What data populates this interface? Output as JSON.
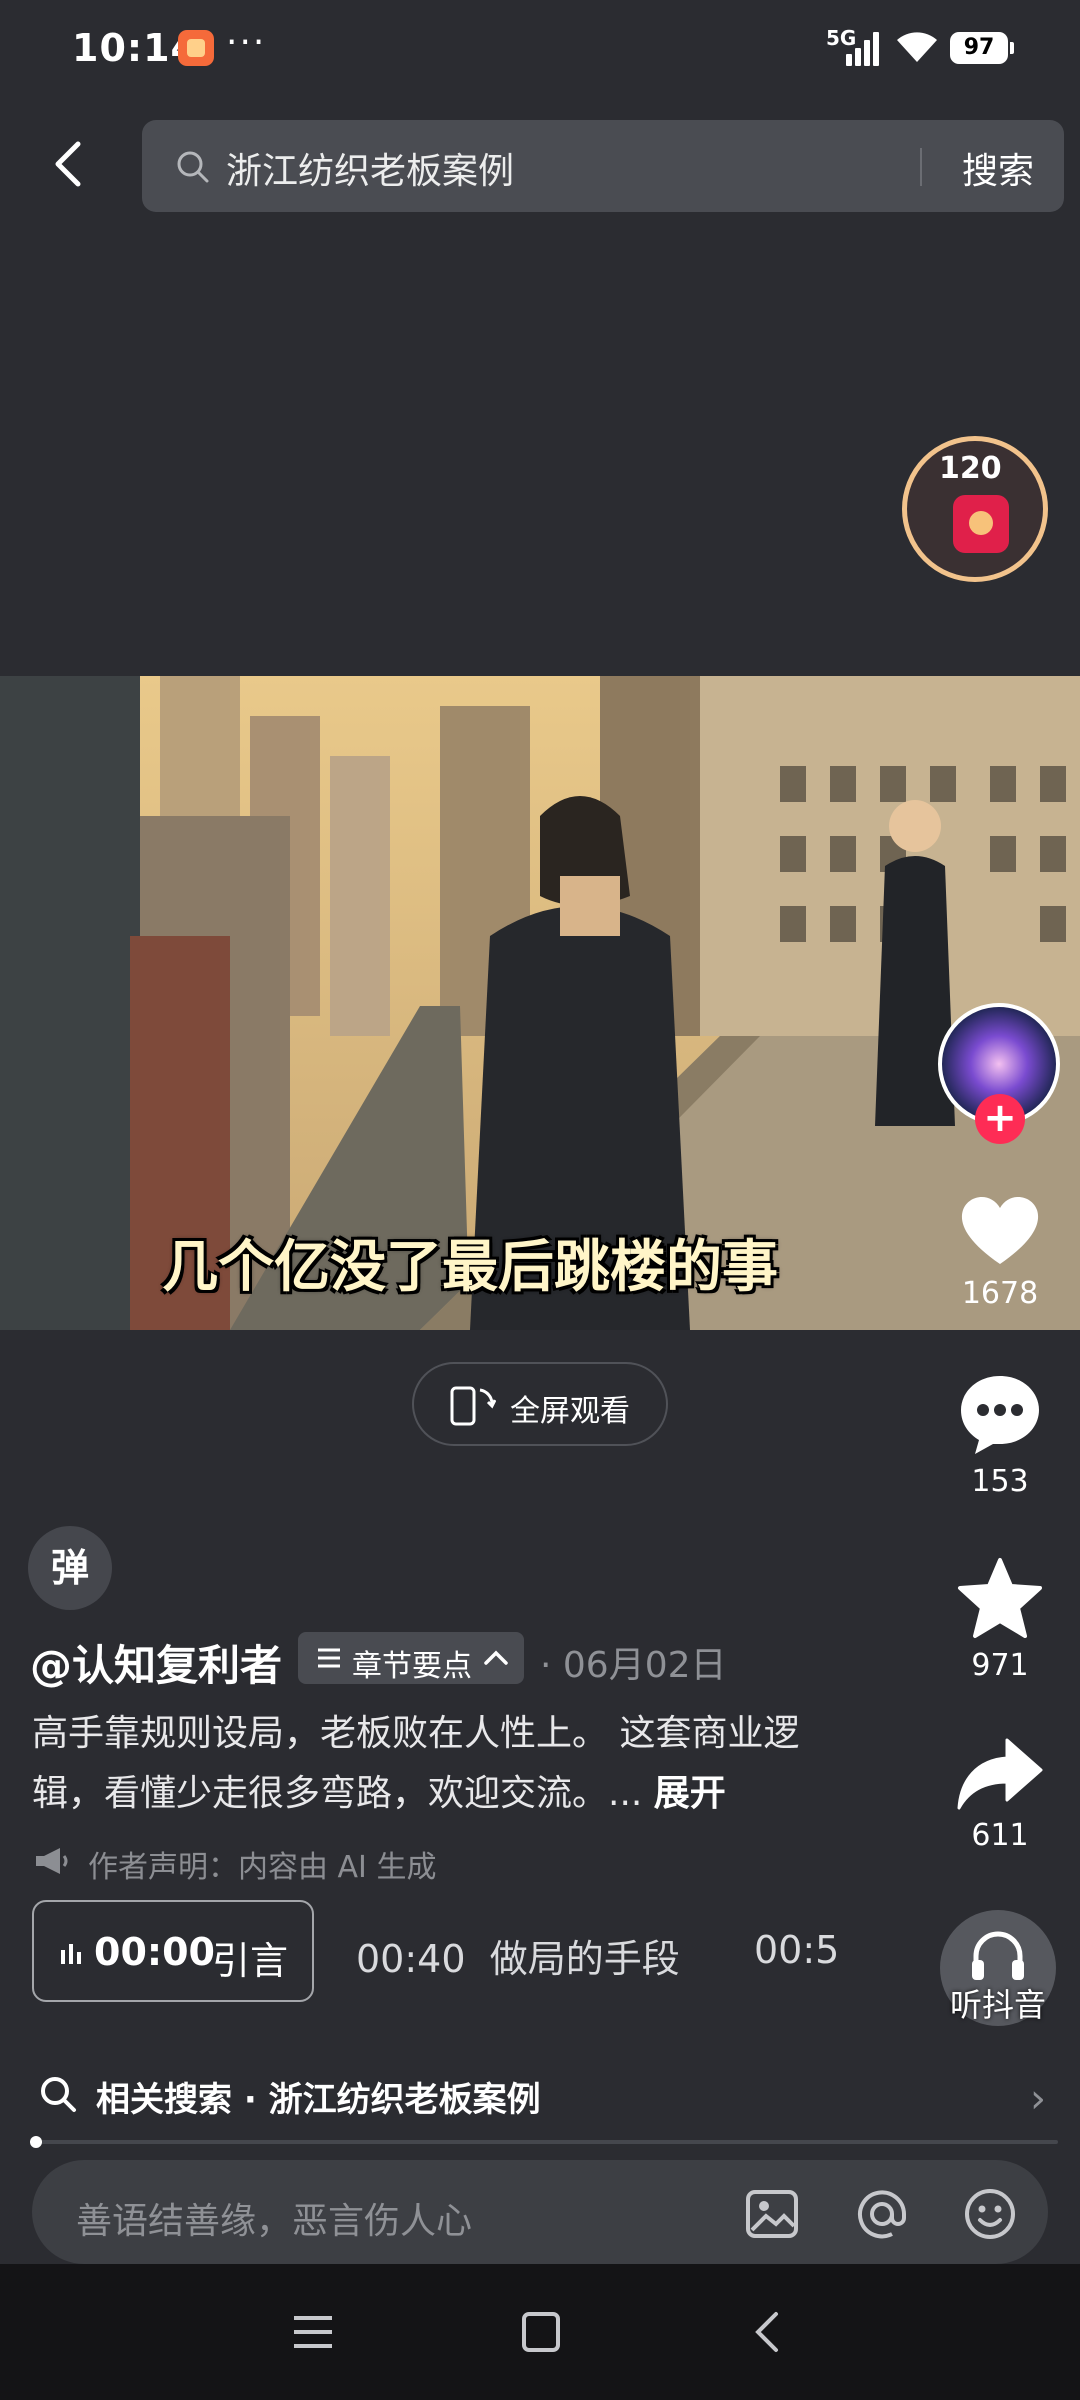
{
  "status_bar": {
    "time": "10:14",
    "dots": "···",
    "network": "5G",
    "battery": "97"
  },
  "search": {
    "query": "浙江纺织老板案例",
    "button": "搜索"
  },
  "red_packet": {
    "coins": "120"
  },
  "video": {
    "caption": "几个亿没了最后跳楼的事"
  },
  "actions": {
    "likes": "1678",
    "comments": "153",
    "favorites": "971",
    "shares": "611",
    "listen_label": "听抖音"
  },
  "fullscreen": {
    "label": "全屏观看"
  },
  "danmaku": {
    "label": "弹"
  },
  "post": {
    "author": "@认知复利者",
    "chapter_chip": "章节要点",
    "date": "· 06月02日",
    "description": "高手靠规则设局，老板败在人性上。 这套商业逻辑，看懂少走很多弯路，欢迎交流。...",
    "expand": "展开",
    "disclaimer": "作者声明：内容由 AI 生成"
  },
  "chapters": [
    {
      "time": "00:00",
      "title": "引言"
    },
    {
      "time": "00:40",
      "title": "做局的手段"
    },
    {
      "time": "00:5",
      "title": ""
    }
  ],
  "related_search": {
    "label": "相关搜索 · 浙江纺织老板案例"
  },
  "progress": {
    "fraction": 0.01
  },
  "comment": {
    "placeholder": "善语结善缘，恶言伤人心"
  },
  "icons": [
    "back-icon",
    "search-icon",
    "heart-icon",
    "comment-icon",
    "star-icon",
    "share-icon",
    "headphones-icon",
    "image-icon",
    "at-icon",
    "emoji-icon",
    "menu-icon",
    "home-icon",
    "nav-back-icon"
  ],
  "colors": {
    "background": "#2b2c31",
    "accent": "#fe2c55"
  }
}
